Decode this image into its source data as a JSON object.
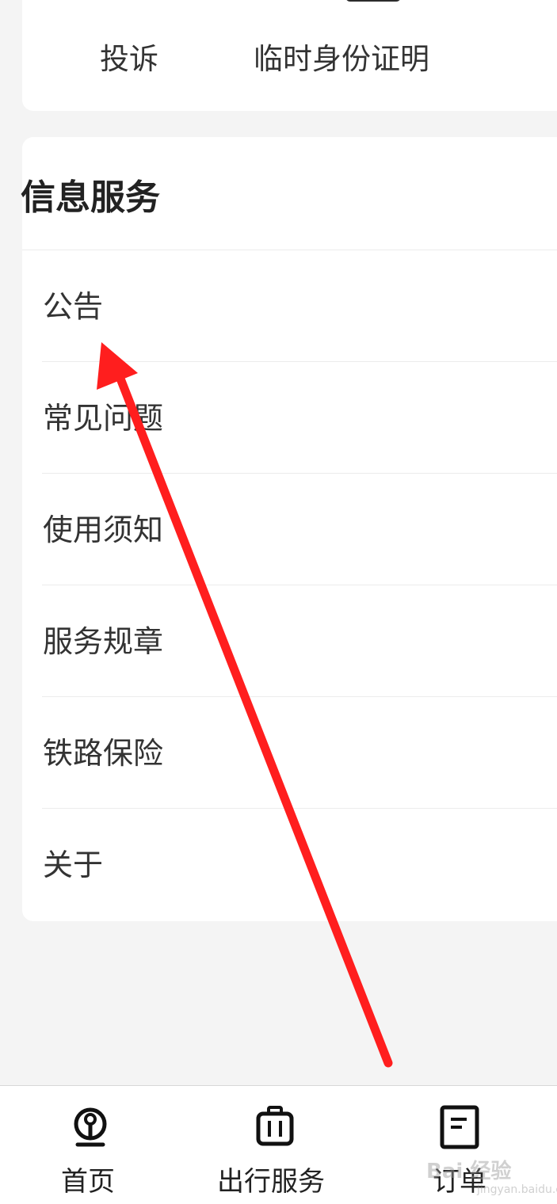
{
  "top_card": {
    "items": [
      {
        "label": "投诉"
      },
      {
        "label": "临时身份证明"
      }
    ]
  },
  "info_section": {
    "title": "信息服务",
    "items": [
      {
        "label": "公告"
      },
      {
        "label": "常见问题"
      },
      {
        "label": "使用须知"
      },
      {
        "label": "服务规章"
      },
      {
        "label": "铁路保险"
      },
      {
        "label": "关于"
      }
    ]
  },
  "tabbar": {
    "tabs": [
      {
        "label": "首页",
        "icon": "railway-logo-icon"
      },
      {
        "label": "出行服务",
        "icon": "luggage-icon"
      },
      {
        "label": "订单",
        "icon": "order-document-icon"
      }
    ]
  },
  "annotation": {
    "arrow_color": "#ff1e1e"
  },
  "watermark": {
    "text": "Bai 经验",
    "sub": "jingyan.baidu.com"
  }
}
